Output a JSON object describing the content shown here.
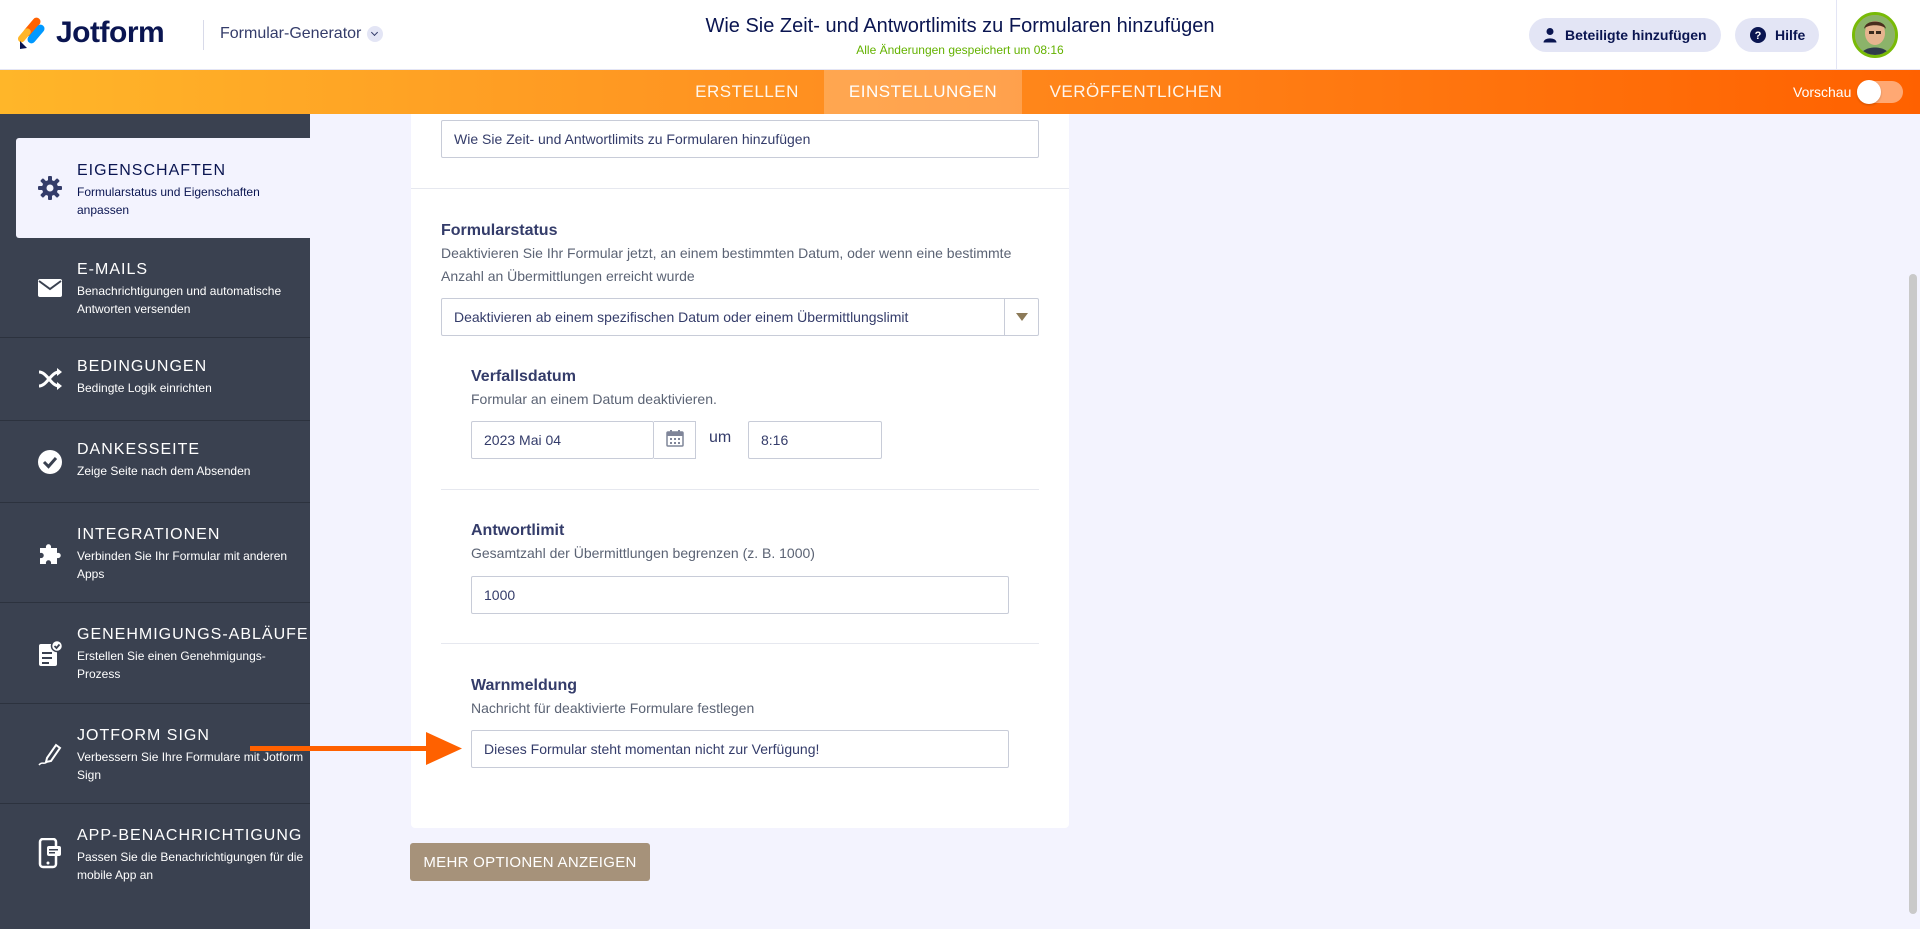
{
  "header": {
    "logo_text": "Jotform",
    "builder_label": "Formular-Generator",
    "page_title": "Wie Sie Zeit- und Antwortlimits zu Formularen hinzufügen",
    "save_status": "Alle Änderungen gespeichert um 08:16",
    "invite_label": "Beteiligte hinzufügen",
    "help_label": "Hilfe"
  },
  "nav": {
    "tabs": [
      {
        "label": "ERSTELLEN"
      },
      {
        "label": "EINSTELLUNGEN"
      },
      {
        "label": "VERÖFFENTLICHEN"
      }
    ],
    "preview_label": "Vorschau"
  },
  "sidebar": {
    "items": [
      {
        "title": "EIGENSCHAFTEN",
        "desc": "Formularstatus und Eigenschaften anpassen",
        "icon": "gear-icon"
      },
      {
        "title": "E-MAILS",
        "desc": "Benachrichtigungen und automatische Antworten versenden",
        "icon": "envelope-icon"
      },
      {
        "title": "BEDINGUNGEN",
        "desc": "Bedingte Logik einrichten",
        "icon": "shuffle-icon"
      },
      {
        "title": "DANKESSEITE",
        "desc": "Zeige Seite nach dem Absenden",
        "icon": "check-circle-icon"
      },
      {
        "title": "INTEGRATIONEN",
        "desc": "Verbinden Sie Ihr Formular mit anderen Apps",
        "icon": "puzzle-icon"
      },
      {
        "title": "GENEHMIGUNGS-ABLÄUFE",
        "desc": "Erstellen Sie einen Genehmigungs-Prozess",
        "icon": "approval-icon"
      },
      {
        "title": "JOTFORM SIGN",
        "desc": "Verbessern Sie Ihre Formulare mit Jotform Sign",
        "icon": "pen-icon"
      },
      {
        "title": "APP-BENACHRICHTIGUNG",
        "desc": "Passen Sie die Benachrichtigungen für die mobile App an",
        "icon": "mobile-icon"
      }
    ]
  },
  "form": {
    "title_value": "Wie Sie Zeit- und Antwortlimits zu Formularen hinzufügen",
    "status": {
      "label": "Formularstatus",
      "desc": "Deaktivieren Sie Ihr Formular jetzt, an einem bestimmten Datum, oder wenn eine bestimmte Anzahl an Übermittlungen erreicht wurde",
      "selected": "Deaktivieren ab einem spezifischen Datum oder einem Übermittlungslimit"
    },
    "expiry": {
      "label": "Verfallsdatum",
      "desc": "Formular an einem Datum deaktivieren.",
      "date_value": "2023 Mai 04",
      "at_label": "um",
      "time_value": "8:16"
    },
    "limit": {
      "label": "Antwortlimit",
      "desc": "Gesamtzahl der Übermittlungen begrenzen (z. B. 1000)",
      "value": "1000"
    },
    "warning": {
      "label": "Warnmeldung",
      "desc": "Nachricht für deaktivierte Formulare festlegen",
      "value": "Dieses Formular steht momentan nicht zur Verfügung!"
    },
    "more_options_label": "MEHR OPTIONEN ANZEIGEN"
  },
  "colors": {
    "accent_orange": "#ff6100",
    "sidebar_bg": "#3a4150",
    "save_green": "#64b200",
    "more_button": "#a6927a"
  }
}
